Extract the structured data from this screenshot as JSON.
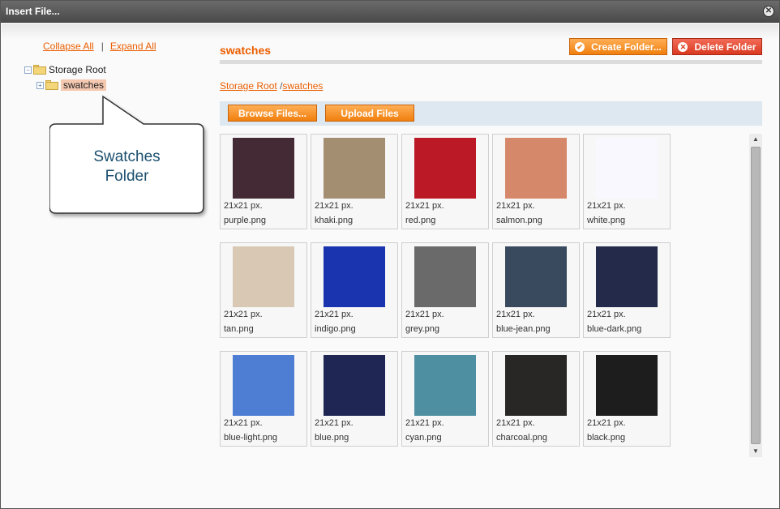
{
  "window": {
    "title": "Insert File..."
  },
  "tree": {
    "collapse_label": "Collapse All",
    "separator": "|",
    "expand_label": "Expand All",
    "root_label": "Storage Root",
    "child_label": "swatches",
    "selected": "swatches"
  },
  "callout": {
    "line1": "Swatches",
    "line2": "Folder"
  },
  "panel": {
    "title": "swatches",
    "create_folder_label": "Create Folder...",
    "delete_folder_label": "Delete Folder",
    "breadcrumb": {
      "root": "Storage Root",
      "separator": "/",
      "current": "swatches"
    },
    "browse_label": "Browse Files...",
    "upload_label": "Upload Files"
  },
  "files": [
    {
      "dim": "21x21 px.",
      "name": "purple.png",
      "color": "#432a34"
    },
    {
      "dim": "21x21 px.",
      "name": "khaki.png",
      "color": "#a48e72"
    },
    {
      "dim": "21x21 px.",
      "name": "red.png",
      "color": "#bb1926"
    },
    {
      "dim": "21x21 px.",
      "name": "salmon.png",
      "color": "#d5896a"
    },
    {
      "dim": "21x21 px.",
      "name": "white.png",
      "color": "#f8f8fe"
    },
    {
      "dim": "21x21 px.",
      "name": "tan.png",
      "color": "#d8c8b4"
    },
    {
      "dim": "21x21 px.",
      "name": "indigo.png",
      "color": "#1a34b0"
    },
    {
      "dim": "21x21 px.",
      "name": "grey.png",
      "color": "#6a6a6a"
    },
    {
      "dim": "21x21 px.",
      "name": "blue-jean.png",
      "color": "#3a4a5e"
    },
    {
      "dim": "21x21 px.",
      "name": "blue-dark.png",
      "color": "#232a4a"
    },
    {
      "dim": "21x21 px.",
      "name": "blue-light.png",
      "color": "#4e7ed4"
    },
    {
      "dim": "21x21 px.",
      "name": "blue.png",
      "color": "#1f2653"
    },
    {
      "dim": "21x21 px.",
      "name": "cyan.png",
      "color": "#4f8fa2"
    },
    {
      "dim": "21x21 px.",
      "name": "charcoal.png",
      "color": "#282725"
    },
    {
      "dim": "21x21 px.",
      "name": "black.png",
      "color": "#1d1d1d"
    }
  ]
}
